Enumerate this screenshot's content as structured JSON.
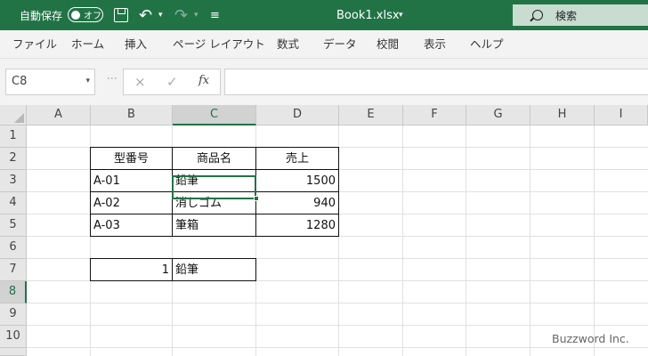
{
  "titlebar": {
    "autosave_label": "自動保存",
    "autosave_state": "オフ",
    "filename": "Book1.xlsx",
    "search_label": "検索",
    "accent_color": "#217346"
  },
  "menu": {
    "items": [
      "ファイル",
      "ホーム",
      "挿入",
      "ページ レイアウト",
      "数式",
      "データ",
      "校閲",
      "表示",
      "ヘルプ"
    ]
  },
  "formula_bar": {
    "name_box": "C8",
    "fx_label": "fx",
    "cancel_icon": "×",
    "confirm_icon": "✓",
    "value": ""
  },
  "sheet": {
    "columns": [
      "A",
      "B",
      "C",
      "D",
      "E",
      "F",
      "G",
      "H",
      "I"
    ],
    "rows": [
      "1",
      "2",
      "3",
      "4",
      "5",
      "6",
      "7",
      "8",
      "9",
      "10"
    ],
    "selected_column": "C",
    "selected_row": "8",
    "table": {
      "headers": [
        "型番号",
        "商品名",
        "売上"
      ],
      "rows": [
        [
          "A-01",
          "鉛筆",
          "1500"
        ],
        [
          "A-02",
          "消しゴム",
          "940"
        ],
        [
          "A-03",
          "筆箱",
          "1280"
        ]
      ]
    },
    "lookup": {
      "index": "1",
      "result": "鉛筆"
    }
  },
  "watermark": "Buzzword Inc."
}
